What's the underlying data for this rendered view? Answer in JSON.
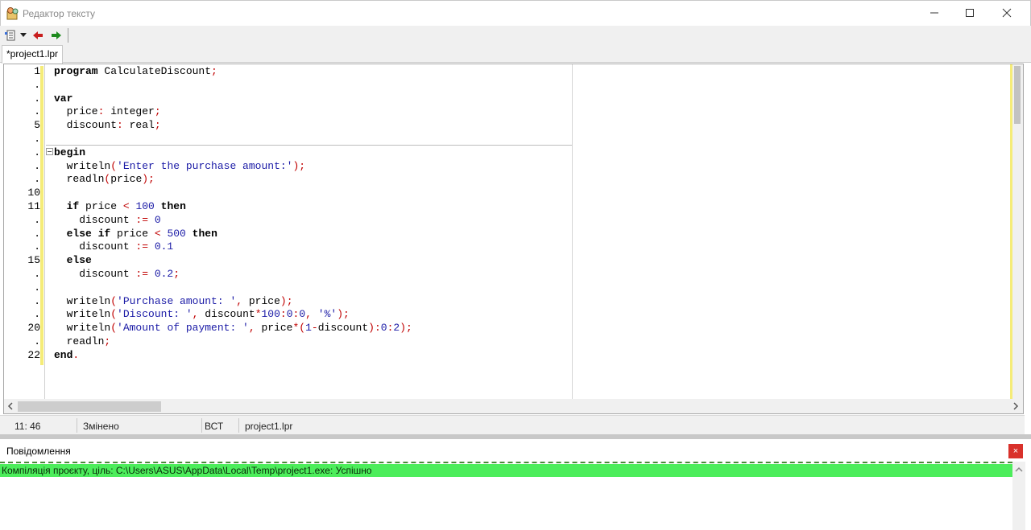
{
  "window": {
    "title": "Редактор тексту",
    "icon": "app-icon",
    "controls": [
      "minimize-icon",
      "maximize-icon",
      "close-icon"
    ]
  },
  "toolbar": {
    "items": [
      "new-file-icon",
      "dropdown-arrow-icon",
      "back-arrow-icon",
      "forward-arrow-icon"
    ]
  },
  "tabs": [
    {
      "label": "*project1.lpr",
      "active": true
    }
  ],
  "editor": {
    "gutter": [
      "1",
      ".",
      ".",
      ".",
      "5",
      ".",
      ".",
      ".",
      ".",
      "10",
      "11",
      ".",
      ".",
      ".",
      "15",
      ".",
      ".",
      ".",
      ".",
      "20",
      ".",
      "22"
    ],
    "code": [
      [
        [
          "kw",
          "program"
        ],
        [
          "id",
          " CalculateDiscount"
        ],
        [
          "sym",
          ";"
        ]
      ],
      [],
      [
        [
          "kw",
          "var"
        ]
      ],
      [
        [
          "id",
          "  price"
        ],
        [
          "sym",
          ":"
        ],
        [
          "id",
          " integer"
        ],
        [
          "sym",
          ";"
        ]
      ],
      [
        [
          "id",
          "  discount"
        ],
        [
          "sym",
          ":"
        ],
        [
          "id",
          " real"
        ],
        [
          "sym",
          ";"
        ]
      ],
      [],
      [
        [
          "kw",
          "begin"
        ]
      ],
      [
        [
          "id",
          "  writeln"
        ],
        [
          "sym",
          "("
        ],
        [
          "str",
          "'Enter the purchase amount:'"
        ],
        [
          "sym",
          ");"
        ]
      ],
      [
        [
          "id",
          "  readln"
        ],
        [
          "sym",
          "("
        ],
        [
          "id",
          "price"
        ],
        [
          "sym",
          ");"
        ]
      ],
      [],
      [
        [
          "kw",
          "  if"
        ],
        [
          "id",
          " price "
        ],
        [
          "sym",
          "<"
        ],
        [
          "num",
          " 100"
        ],
        [
          "kw",
          " then"
        ]
      ],
      [
        [
          "id",
          "    discount "
        ],
        [
          "sym",
          ":="
        ],
        [
          "num",
          " 0"
        ]
      ],
      [
        [
          "kw",
          "  else if"
        ],
        [
          "id",
          " price "
        ],
        [
          "sym",
          "<"
        ],
        [
          "num",
          " 500"
        ],
        [
          "kw",
          " then"
        ]
      ],
      [
        [
          "id",
          "    discount "
        ],
        [
          "sym",
          ":="
        ],
        [
          "num",
          " 0.1"
        ]
      ],
      [
        [
          "kw",
          "  else"
        ]
      ],
      [
        [
          "id",
          "    discount "
        ],
        [
          "sym",
          ":="
        ],
        [
          "num",
          " 0.2"
        ],
        [
          "sym",
          ";"
        ]
      ],
      [],
      [
        [
          "id",
          "  writeln"
        ],
        [
          "sym",
          "("
        ],
        [
          "str",
          "'Purchase amount: '"
        ],
        [
          "sym",
          ","
        ],
        [
          "id",
          " price"
        ],
        [
          "sym",
          ");"
        ]
      ],
      [
        [
          "id",
          "  writeln"
        ],
        [
          "sym",
          "("
        ],
        [
          "str",
          "'Discount: '"
        ],
        [
          "sym",
          ","
        ],
        [
          "id",
          " discount"
        ],
        [
          "sym",
          "*"
        ],
        [
          "num",
          "100"
        ],
        [
          "sym",
          ":"
        ],
        [
          "num",
          "0"
        ],
        [
          "sym",
          ":"
        ],
        [
          "num",
          "0"
        ],
        [
          "sym",
          ","
        ],
        [
          "str",
          " '%'"
        ],
        [
          "sym",
          ");"
        ]
      ],
      [
        [
          "id",
          "  writeln"
        ],
        [
          "sym",
          "("
        ],
        [
          "str",
          "'Amount of payment: '"
        ],
        [
          "sym",
          ","
        ],
        [
          "id",
          " price"
        ],
        [
          "sym",
          "*("
        ],
        [
          "num",
          "1"
        ],
        [
          "sym",
          "-"
        ],
        [
          "id",
          "discount"
        ],
        [
          "sym",
          ")"
        ],
        [
          "sym",
          ":"
        ],
        [
          "num",
          "0"
        ],
        [
          "sym",
          ":"
        ],
        [
          "num",
          "2"
        ],
        [
          "sym",
          ");"
        ]
      ],
      [
        [
          "id",
          "  readln"
        ],
        [
          "sym",
          ";"
        ]
      ],
      [
        [
          "kw",
          "end"
        ],
        [
          "sym",
          "."
        ]
      ]
    ]
  },
  "statusbar": {
    "position": "11:  46",
    "state": "Змінено",
    "mode": "ВСТ",
    "file": "project1.lpr"
  },
  "messages": {
    "title": "Повідомлення",
    "close_label": "×",
    "lines": [
      "Компіляція проєкту, ціль: C:\\Users\\ASUS\\AppData\\Local\\Temp\\project1.exe: Успішно"
    ],
    "success_color": "#4ced5b"
  }
}
